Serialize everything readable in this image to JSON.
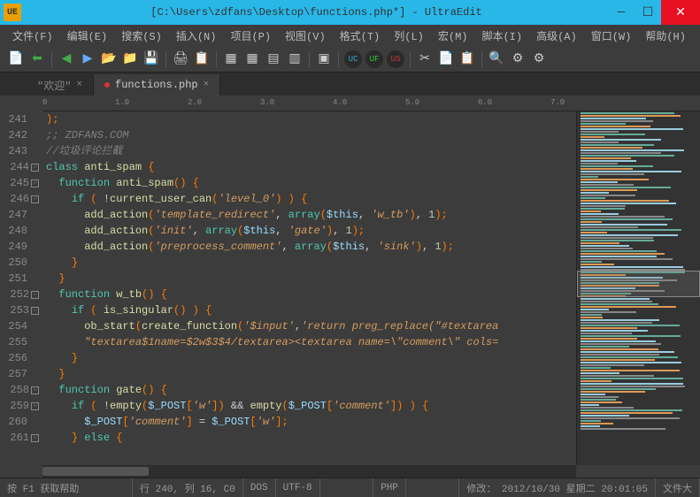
{
  "title": "[C:\\Users\\zdfans\\Desktop\\functions.php*] - UltraEdit",
  "app_icon": "UE",
  "menu": [
    "文件(F)",
    "编辑(E)",
    "搜索(S)",
    "插入(N)",
    "项目(P)",
    "视图(V)",
    "格式(T)",
    "列(L)",
    "宏(M)",
    "脚本(I)",
    "高级(A)",
    "窗口(W)",
    "帮助(H)"
  ],
  "tabs": [
    {
      "label": "\"欢迎\"",
      "active": false
    },
    {
      "label": "functions.php",
      "active": true
    }
  ],
  "ruler": {
    "marks": [
      "0",
      "1.0",
      "2.0",
      "3.0",
      "4.0",
      "5.0",
      "6.0",
      "7.0"
    ]
  },
  "lines": [
    {
      "n": 241,
      "fold": "",
      "html": "<span class='br'>);</span>"
    },
    {
      "n": 242,
      "fold": "",
      "html": "<span class='cm'>;; ZDFANS.COM</span>"
    },
    {
      "n": 243,
      "fold": "",
      "html": "<span class='cm'>//垃圾评论拦截</span>"
    },
    {
      "n": 244,
      "fold": "-",
      "html": "<span class='kw'>class</span> <span class='fn'>anti_spam</span> <span class='br'>{</span>"
    },
    {
      "n": 245,
      "fold": "-",
      "html": "  <span class='kw'>function</span> <span class='fn'>anti_spam</span><span class='br'>()</span> <span class='br'>{</span>"
    },
    {
      "n": 246,
      "fold": "-",
      "html": "    <span class='kw'>if</span> <span class='br'>(</span> <span class='op'>!</span><span class='fn'>current_user_can</span><span class='br'>(</span><span class='str'>'level_0'</span><span class='br'>)</span> <span class='br'>)</span> <span class='br'>{</span>"
    },
    {
      "n": 247,
      "fold": "",
      "html": "      <span class='fn'>add_action</span><span class='br'>(</span><span class='str'>'template_redirect'</span>, <span class='kw'>array</span><span class='br'>(</span><span class='var'>$this</span>, <span class='str'>'w_tb'</span><span class='br'>)</span>, <span class='num'>1</span><span class='br'>);</span>"
    },
    {
      "n": 248,
      "fold": "",
      "html": "      <span class='fn'>add_action</span><span class='br'>(</span><span class='str'>'init'</span>, <span class='kw'>array</span><span class='br'>(</span><span class='var'>$this</span>, <span class='str'>'gate'</span><span class='br'>)</span>, <span class='num'>1</span><span class='br'>);</span>"
    },
    {
      "n": 249,
      "fold": "",
      "html": "      <span class='fn'>add_action</span><span class='br'>(</span><span class='str'>'preprocess_comment'</span>, <span class='kw'>array</span><span class='br'>(</span><span class='var'>$this</span>, <span class='str'>'sink'</span><span class='br'>)</span>, <span class='num'>1</span><span class='br'>);</span>"
    },
    {
      "n": 250,
      "fold": "",
      "html": "    <span class='br'>}</span>"
    },
    {
      "n": 251,
      "fold": "",
      "html": "  <span class='br'>}</span>"
    },
    {
      "n": 252,
      "fold": "-",
      "html": "  <span class='kw'>function</span> <span class='fn'>w_tb</span><span class='br'>()</span> <span class='br'>{</span>"
    },
    {
      "n": 253,
      "fold": "-",
      "html": "    <span class='kw'>if</span> <span class='br'>(</span> <span class='fn'>is_singular</span><span class='br'>()</span> <span class='br'>)</span> <span class='br'>{</span>"
    },
    {
      "n": 254,
      "fold": "",
      "html": "      <span class='fn'>ob_start</span><span class='br'>(</span><span class='fn'>create_function</span><span class='br'>(</span><span class='str'>'$input'</span>,<span class='str'>'return preg_replace(\"#textarea</span>"
    },
    {
      "n": 255,
      "fold": "",
      "html": "      <span class='str'>\"textarea$1name=$2w$3$4/textarea&gt;&lt;textarea name=\\\"comment\\\" cols=</span>"
    },
    {
      "n": 256,
      "fold": "",
      "html": "    <span class='br'>}</span>"
    },
    {
      "n": 257,
      "fold": "",
      "html": "  <span class='br'>}</span>"
    },
    {
      "n": 258,
      "fold": "-",
      "html": "  <span class='kw'>function</span> <span class='fn'>gate</span><span class='br'>()</span> <span class='br'>{</span>"
    },
    {
      "n": 259,
      "fold": "-",
      "html": "    <span class='kw'>if</span> <span class='br'>(</span> <span class='op'>!</span><span class='fn'>empty</span><span class='br'>(</span><span class='var'>$_POST</span><span class='br'>[</span><span class='str'>'w'</span><span class='br'>])</span> <span class='op'>&amp;&amp;</span> <span class='fn'>empty</span><span class='br'>(</span><span class='var'>$_POST</span><span class='br'>[</span><span class='str'>'comment'</span><span class='br'>])</span> <span class='br'>)</span> <span class='br'>{</span>"
    },
    {
      "n": 260,
      "fold": "",
      "html": "      <span class='var'>$_POST</span><span class='br'>[</span><span class='str'>'comment'</span><span class='br'>]</span> <span class='op'>=</span> <span class='var'>$_POST</span><span class='br'>[</span><span class='str'>'w'</span><span class='br'>];</span>"
    },
    {
      "n": 261,
      "fold": "-",
      "html": "    <span class='br'>}</span> <span class='kw'>else</span> <span class='br'>{</span>"
    }
  ],
  "status": {
    "help": "按 F1 获取帮助",
    "pos": "行 240, 列 16, C0",
    "eol": "DOS",
    "enc": "UTF-8",
    "lang": "PHP",
    "mod": "修改： 2012/10/30 星期二 20:01:05",
    "size": "文件大"
  }
}
